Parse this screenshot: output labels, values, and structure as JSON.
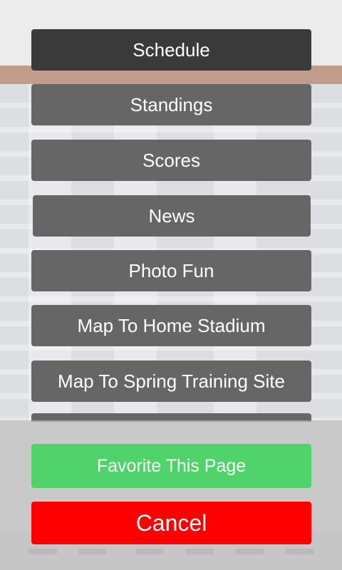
{
  "menu": {
    "schedule": "Schedule",
    "standings": "Standings",
    "scores": "Scores",
    "news": "News",
    "photo_fun": "Photo Fun",
    "map_home": "Map To Home Stadium",
    "map_spring": "Map To Spring Training Site"
  },
  "actions": {
    "favorite": "Favorite This Page",
    "cancel": "Cancel"
  },
  "colors": {
    "menu_button": "#666666",
    "menu_button_active": "#3a3a3a",
    "favorite": "#4fd36a",
    "cancel": "#ff0000",
    "text": "#ffffff"
  }
}
